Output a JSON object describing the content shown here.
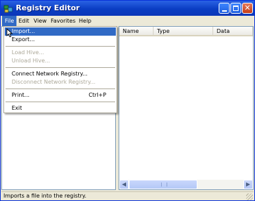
{
  "window": {
    "title": "Registry Editor"
  },
  "menubar": {
    "items": [
      "File",
      "Edit",
      "View",
      "Favorites",
      "Help"
    ]
  },
  "list": {
    "columns": [
      "Name",
      "Type",
      "Data"
    ]
  },
  "file_menu": {
    "items": [
      {
        "label": "Import...",
        "shortcut": "",
        "enabled": true,
        "highlighted": true
      },
      {
        "label": "Export...",
        "shortcut": "",
        "enabled": true
      },
      {
        "label": "Load Hive...",
        "shortcut": "",
        "enabled": false
      },
      {
        "label": "Unload Hive...",
        "shortcut": "",
        "enabled": false
      },
      {
        "label": "Connect Network Registry...",
        "shortcut": "",
        "enabled": true
      },
      {
        "label": "Disconnect Network Registry...",
        "shortcut": "",
        "enabled": false
      },
      {
        "label": "Print...",
        "shortcut": "Ctrl+P",
        "enabled": true
      },
      {
        "label": "Exit",
        "shortcut": "",
        "enabled": true
      }
    ]
  },
  "statusbar": {
    "text": "Imports a file into the registry."
  },
  "icons": {
    "app": "registry-icon",
    "minimize": "minimize-icon",
    "maximize": "maximize-icon",
    "close": "close-icon",
    "scroll_left": "arrow-left-icon",
    "scroll_right": "arrow-right-icon",
    "pointer": "mouse-pointer-icon"
  },
  "colors": {
    "titlebar": "#0a3dc3",
    "highlight": "#316ac5",
    "close_button": "#c63d17",
    "disabled_text": "#aca899"
  }
}
